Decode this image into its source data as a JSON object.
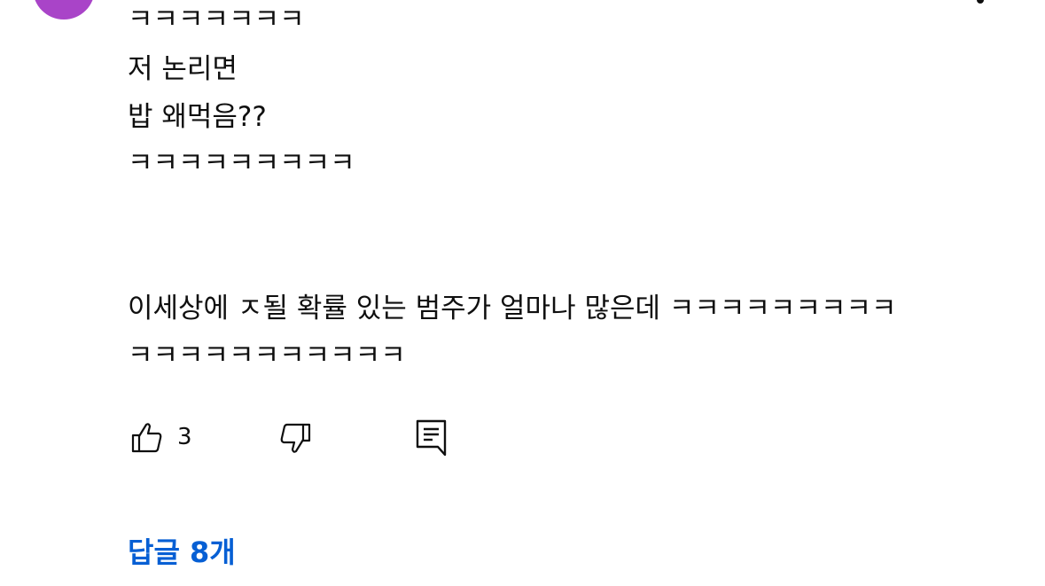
{
  "comment": {
    "avatar_initial": "",
    "lines": [
      "ㅋㅋㅋㅋㅋㅋㅋ",
      "저 논리면",
      "밥 왜먹음??",
      "ㅋㅋㅋㅋㅋㅋㅋㅋㅋ",
      "이세상에 ㅈ될 확률 있는 범주가 얼마나 많은데 ㅋㅋㅋㅋㅋㅋㅋㅋㅋ",
      "ㅋㅋㅋㅋㅋㅋㅋㅋㅋㅋㅋ"
    ]
  },
  "actions": {
    "like_count": "3",
    "like_icon": "thumbs-up-icon",
    "dislike_icon": "thumbs-down-icon",
    "reply_icon": "reply-comment-icon"
  },
  "replies": {
    "label": "답글 8개"
  },
  "colors": {
    "avatar": "#a944c8",
    "replies_link": "#065fd4",
    "text": "#0f0f0f"
  }
}
